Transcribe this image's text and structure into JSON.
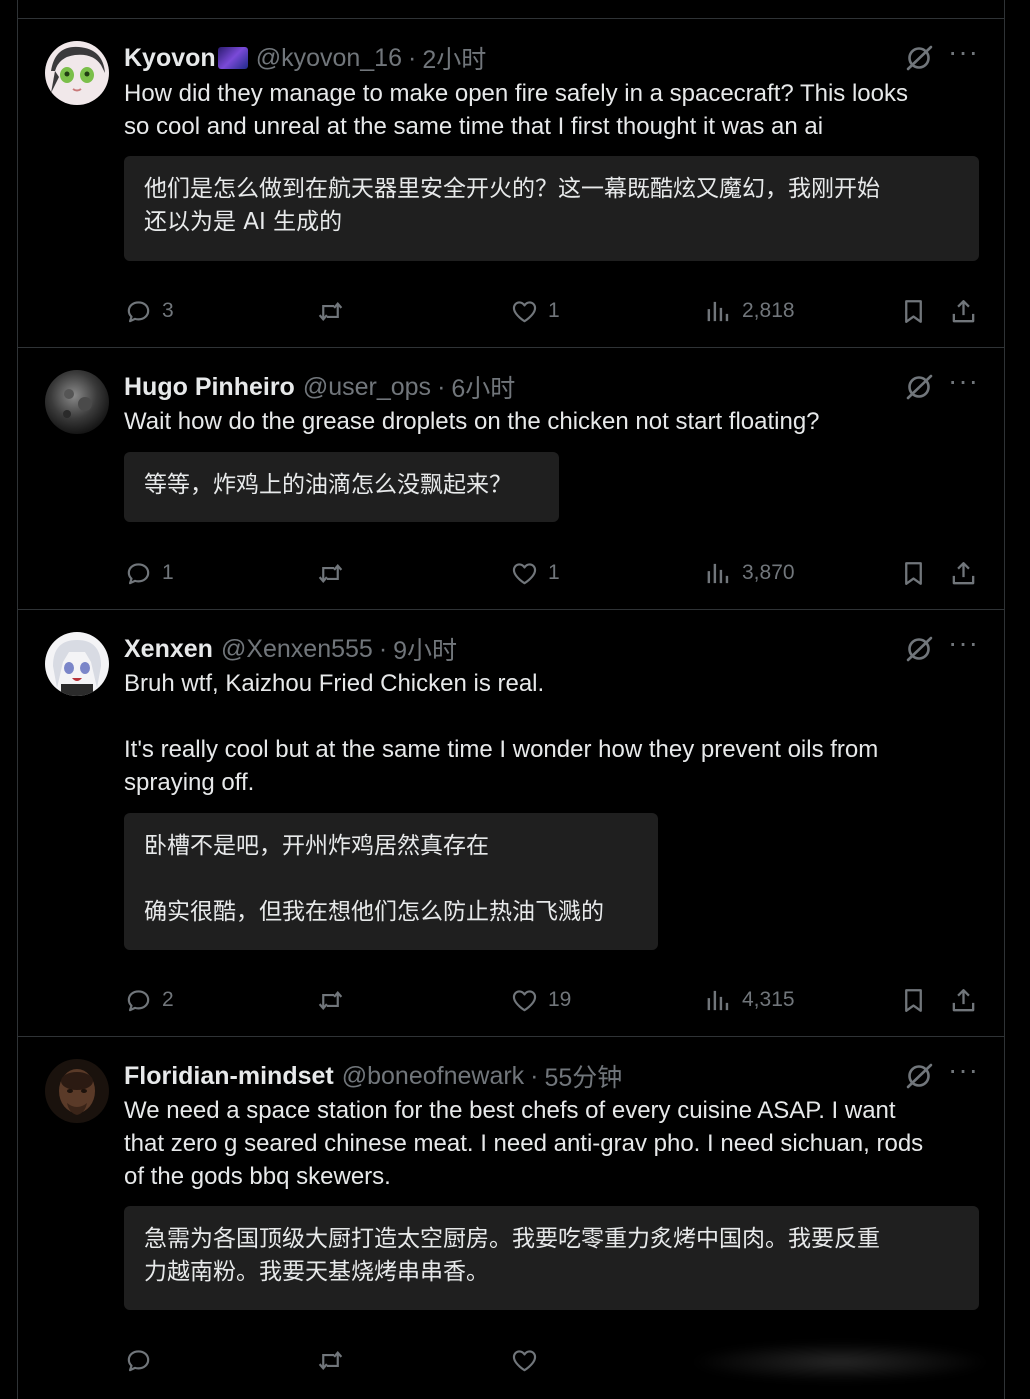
{
  "tweets": [
    {
      "name": "Kyovon",
      "has_emoji": true,
      "handle": "@kyovon_16",
      "time": "2小时",
      "text": [
        "How did they manage to make open fire safely in a spacecraft? This looks",
        "so cool and unreal at the same time that I first thought it was an ai"
      ],
      "translation": [
        "他们是怎么做到在航天器里安全开火的？这一幕既酷炫又魔幻，我刚开始",
        "还以为是 AI 生成的"
      ],
      "replies": "3",
      "likes": "1",
      "views": "2,818"
    },
    {
      "name": "Hugo Pinheiro",
      "handle": "@user_ops",
      "time": "6小时",
      "text": [
        "Wait how do the grease droplets on the chicken not start floating?"
      ],
      "translation": [
        "等等，炸鸡上的油滴怎么没飘起来？"
      ],
      "replies": "1",
      "likes": "1",
      "views": "3,870"
    },
    {
      "name": "Xenxen",
      "handle": "@Xenxen555",
      "time": "9小时",
      "text": [
        "Bruh wtf, Kaizhou Fried Chicken is real.",
        "",
        "It's really cool but at the same time I wonder how they prevent  oils from",
        "spraying off."
      ],
      "translation": [
        "卧槽不是吧，开州炸鸡居然真存在",
        "",
        "确实很酷，但我在想他们怎么防止热油飞溅的"
      ],
      "replies": "2",
      "likes": "19",
      "views": "4,315"
    },
    {
      "name": "Floridian-mindset",
      "handle": "@boneofnewark",
      "time": "55分钟",
      "text": [
        "We need a space station for the best chefs of every cuisine ASAP. I want",
        "that zero g seared chinese meat. I need anti-grav pho. I need sichuan, rods",
        "of the gods bbq skewers."
      ],
      "translation": [
        "急需为各国顶级大厨打造太空厨房。我要吃零重力炙烤中国肉。我要反重",
        "力越南粉。我要天基烧烤串串香。"
      ]
    }
  ],
  "separator": "·",
  "more_glyph": "···"
}
